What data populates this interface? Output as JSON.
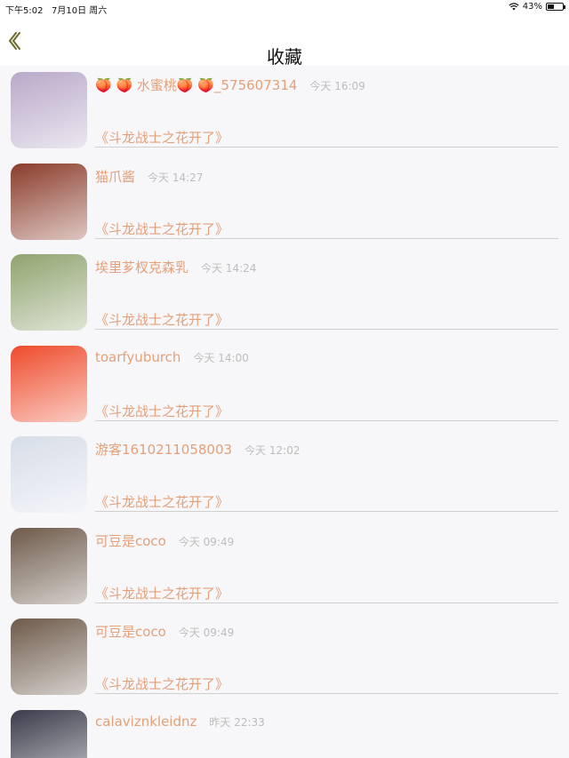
{
  "status_bar": {
    "time": "下午5:02",
    "date": "7月10日 周六",
    "battery_text": "43%",
    "battery_level": 0.43
  },
  "header": {
    "title": "收藏"
  },
  "items": [
    {
      "name": "🍑 🍑 水蜜桃🍑 🍑_575607314",
      "time": "今天 16:09",
      "book": "《斗龙战士之花开了》",
      "avatar_color": "#b8a9c9"
    },
    {
      "name": "猫爪酱",
      "time": "今天 14:27",
      "book": "《斗龙战士之花开了》",
      "avatar_color": "#8a3b2a"
    },
    {
      "name": "埃里芗杈克森乳",
      "time": "今天 14:24",
      "book": "《斗龙战士之花开了》",
      "avatar_color": "#8fa36e"
    },
    {
      "name": "toarfyuburch",
      "time": "今天 14:00",
      "book": "《斗龙战士之花开了》",
      "avatar_color": "#ee4a2a"
    },
    {
      "name": "游客1610211058003",
      "time": "今天 12:02",
      "book": "《斗龙战士之花开了》",
      "avatar_color": "#d7dde8"
    },
    {
      "name": "可豆是coco",
      "time": "今天 09:49",
      "book": "《斗龙战士之花开了》",
      "avatar_color": "#6d5a4a"
    },
    {
      "name": "可豆是coco",
      "time": "今天 09:49",
      "book": "《斗龙战士之花开了》",
      "avatar_color": "#6d5a4a"
    },
    {
      "name": "calaviznkleidnz",
      "time": "昨天 22:33",
      "book": "",
      "avatar_color": "#3a3a4a"
    }
  ]
}
